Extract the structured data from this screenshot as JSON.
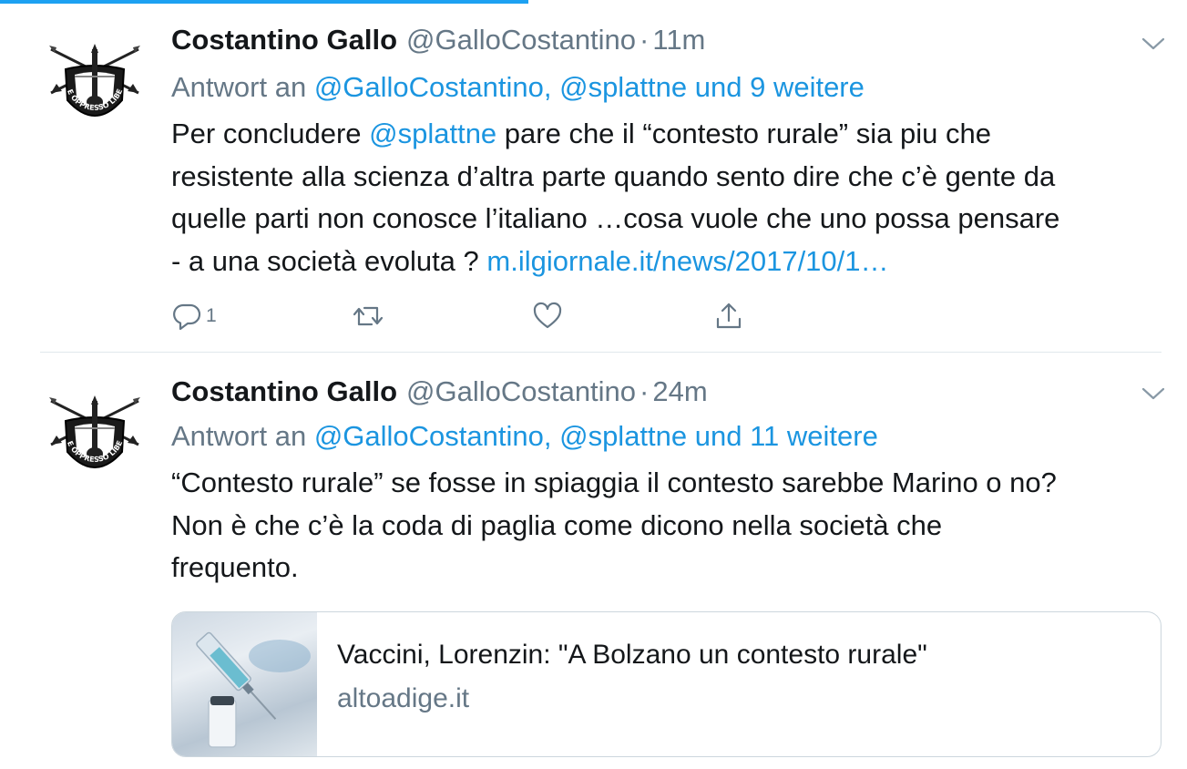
{
  "tweets": [
    {
      "display_name": "Costantino Gallo",
      "handle": "@GalloCostantino",
      "separator": "·",
      "time": "11m",
      "reply_prefix": "Antwort an",
      "reply_targets": "@GalloCostantino, @splattne und 9 weitere",
      "body": {
        "line1_a": "Per concludere ",
        "line1_mention": "@splattne",
        "line1_b": " pare che il “contesto rurale” sia piu che",
        "line2": "resistente alla scienza d’altra parte quando sento dire che c’è gente da",
        "line3": "quelle parti non conosce l’italiano …cosa vuole che uno possa pensare",
        "line4_a": "- a una società evoluta ? ",
        "line4_link": "m.ilgiornale.it/news/2017/10/1…"
      },
      "reply_count": "1",
      "avatar_text": "DE OPPRESSO LIBER"
    },
    {
      "display_name": "Costantino Gallo",
      "handle": "@GalloCostantino",
      "separator": "·",
      "time": "24m",
      "reply_prefix": "Antwort an",
      "reply_targets": "@GalloCostantino, @splattne und 11 weitere",
      "body": {
        "line1": "“Contesto rurale” se fosse in spiaggia il contesto sarebbe Marino o no?",
        "line2": "Non è che c’è la coda di paglia come dicono nella società che",
        "line3": "frequento."
      },
      "card": {
        "title": "Vaccini, Lorenzin: \"A Bolzano un contesto rurale\"",
        "domain": "altoadige.it"
      },
      "avatar_text": "DE OPPRESSO LIBER"
    }
  ],
  "colors": {
    "accent": "#1da1f2",
    "link": "#1b95e0",
    "text": "#14171a",
    "secondary": "#657786",
    "border": "#e1e8ed"
  },
  "icons": [
    "chevron-down-icon",
    "reply-icon",
    "retweet-icon",
    "like-icon",
    "share-icon"
  ]
}
